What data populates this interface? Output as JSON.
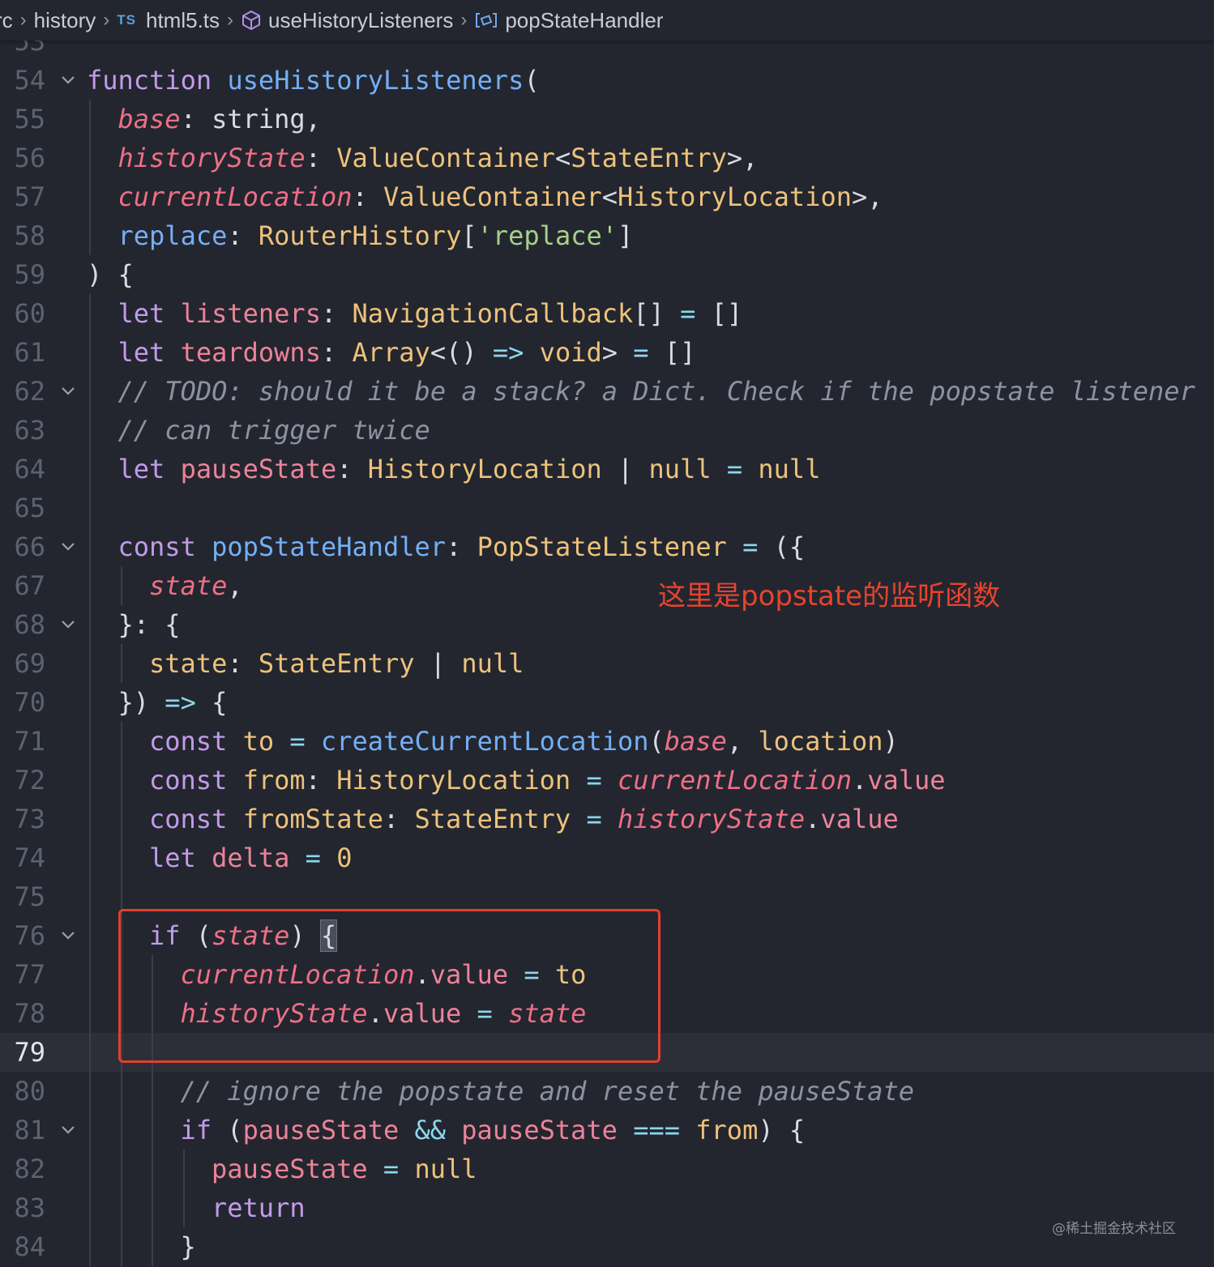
{
  "breadcrumb": {
    "items": [
      "rc",
      "history",
      "html5.ts",
      "useHistoryListeners",
      "popStateHandler"
    ],
    "ts_badge": "TS",
    "icons": [
      "chevron-right-icon",
      "typescript-file-icon",
      "method-cube-icon",
      "variable-icon"
    ]
  },
  "editor": {
    "current_line": "79",
    "lines": [
      {
        "n": "53",
        "tokens": []
      },
      {
        "n": "54",
        "tokens": [
          [
            "kw",
            "function"
          ],
          [
            "plain",
            " "
          ],
          [
            "fn",
            "useHistoryListeners"
          ],
          [
            "plain",
            "("
          ]
        ]
      },
      {
        "n": "55",
        "tokens": [
          [
            "param",
            "base"
          ],
          [
            "plain",
            ": string,"
          ]
        ]
      },
      {
        "n": "56",
        "tokens": [
          [
            "param",
            "historyState"
          ],
          [
            "plain",
            ": "
          ],
          [
            "type",
            "ValueContainer"
          ],
          [
            "plain",
            "<"
          ],
          [
            "type",
            "StateEntry"
          ],
          [
            "plain",
            ">,"
          ]
        ]
      },
      {
        "n": "57",
        "tokens": [
          [
            "param",
            "currentLocation"
          ],
          [
            "plain",
            ": "
          ],
          [
            "type",
            "ValueContainer"
          ],
          [
            "plain",
            "<"
          ],
          [
            "type",
            "HistoryLocation"
          ],
          [
            "plain",
            ">,"
          ]
        ]
      },
      {
        "n": "58",
        "tokens": [
          [
            "fn",
            "replace"
          ],
          [
            "plain",
            ": "
          ],
          [
            "type",
            "RouterHistory"
          ],
          [
            "plain",
            "["
          ],
          [
            "str",
            "'replace'"
          ],
          [
            "plain",
            "]"
          ]
        ]
      },
      {
        "n": "59",
        "tokens": [
          [
            "plain",
            ") {"
          ]
        ]
      },
      {
        "n": "60",
        "tokens": [
          [
            "kw",
            "let"
          ],
          [
            "plain",
            " "
          ],
          [
            "var",
            "listeners"
          ],
          [
            "plain",
            ": "
          ],
          [
            "type",
            "NavigationCallback"
          ],
          [
            "plain",
            "[] "
          ],
          [
            "op",
            "="
          ],
          [
            "plain",
            " []"
          ]
        ]
      },
      {
        "n": "61",
        "tokens": [
          [
            "kw",
            "let"
          ],
          [
            "plain",
            " "
          ],
          [
            "var",
            "teardowns"
          ],
          [
            "plain",
            ": "
          ],
          [
            "type",
            "Array"
          ],
          [
            "plain",
            "<() "
          ],
          [
            "op",
            "=>"
          ],
          [
            "plain",
            " "
          ],
          [
            "type",
            "void"
          ],
          [
            "plain",
            "> "
          ],
          [
            "op",
            "="
          ],
          [
            "plain",
            " []"
          ]
        ]
      },
      {
        "n": "62",
        "tokens": [
          [
            "cmt",
            "// TODO: should it be a stack? a Dict. Check if the popstate listener"
          ]
        ]
      },
      {
        "n": "63",
        "tokens": [
          [
            "cmt",
            "// can trigger twice"
          ]
        ]
      },
      {
        "n": "64",
        "tokens": [
          [
            "kw",
            "let"
          ],
          [
            "plain",
            " "
          ],
          [
            "var",
            "pauseState"
          ],
          [
            "plain",
            ": "
          ],
          [
            "type",
            "HistoryLocation"
          ],
          [
            "plain",
            " | "
          ],
          [
            "type",
            "null"
          ],
          [
            "plain",
            " "
          ],
          [
            "op",
            "="
          ],
          [
            "plain",
            " "
          ],
          [
            "type",
            "null"
          ]
        ]
      },
      {
        "n": "65",
        "tokens": []
      },
      {
        "n": "66",
        "tokens": [
          [
            "kw",
            "const"
          ],
          [
            "plain",
            " "
          ],
          [
            "fn",
            "popStateHandler"
          ],
          [
            "plain",
            ": "
          ],
          [
            "type",
            "PopStateListener"
          ],
          [
            "plain",
            " "
          ],
          [
            "op",
            "="
          ],
          [
            "plain",
            " ({"
          ]
        ]
      },
      {
        "n": "67",
        "tokens": [
          [
            "param",
            "state"
          ],
          [
            "plain",
            ","
          ]
        ]
      },
      {
        "n": "68",
        "tokens": [
          [
            "plain",
            "}: {"
          ]
        ]
      },
      {
        "n": "69",
        "tokens": [
          [
            "type",
            "state"
          ],
          [
            "plain",
            ": "
          ],
          [
            "type",
            "StateEntry"
          ],
          [
            "plain",
            " | "
          ],
          [
            "type",
            "null"
          ]
        ]
      },
      {
        "n": "70",
        "tokens": [
          [
            "plain",
            "}) "
          ],
          [
            "op",
            "=>"
          ],
          [
            "plain",
            " {"
          ]
        ]
      },
      {
        "n": "71",
        "tokens": [
          [
            "kw",
            "const"
          ],
          [
            "plain",
            " "
          ],
          [
            "type",
            "to"
          ],
          [
            "plain",
            " "
          ],
          [
            "op",
            "="
          ],
          [
            "plain",
            " "
          ],
          [
            "fn",
            "createCurrentLocation"
          ],
          [
            "plain",
            "("
          ],
          [
            "param",
            "base"
          ],
          [
            "plain",
            ", "
          ],
          [
            "type",
            "location"
          ],
          [
            "plain",
            ")"
          ]
        ]
      },
      {
        "n": "72",
        "tokens": [
          [
            "kw",
            "const"
          ],
          [
            "plain",
            " "
          ],
          [
            "type",
            "from"
          ],
          [
            "plain",
            ": "
          ],
          [
            "type",
            "HistoryLocation"
          ],
          [
            "plain",
            " "
          ],
          [
            "op",
            "="
          ],
          [
            "plain",
            " "
          ],
          [
            "param",
            "currentLocation"
          ],
          [
            "plain",
            "."
          ],
          [
            "var",
            "value"
          ]
        ]
      },
      {
        "n": "73",
        "tokens": [
          [
            "kw",
            "const"
          ],
          [
            "plain",
            " "
          ],
          [
            "type",
            "fromState"
          ],
          [
            "plain",
            ": "
          ],
          [
            "type",
            "StateEntry"
          ],
          [
            "plain",
            " "
          ],
          [
            "op",
            "="
          ],
          [
            "plain",
            " "
          ],
          [
            "param",
            "historyState"
          ],
          [
            "plain",
            "."
          ],
          [
            "var",
            "value"
          ]
        ]
      },
      {
        "n": "74",
        "tokens": [
          [
            "kw",
            "let"
          ],
          [
            "plain",
            " "
          ],
          [
            "var",
            "delta"
          ],
          [
            "plain",
            " "
          ],
          [
            "op",
            "="
          ],
          [
            "plain",
            " "
          ],
          [
            "type",
            "0"
          ]
        ]
      },
      {
        "n": "75",
        "tokens": []
      },
      {
        "n": "76",
        "tokens": [
          [
            "kw",
            "if"
          ],
          [
            "plain",
            " ("
          ],
          [
            "param",
            "state"
          ],
          [
            "plain",
            ") "
          ],
          [
            "hl",
            "{"
          ]
        ]
      },
      {
        "n": "77",
        "tokens": [
          [
            "param",
            "currentLocation"
          ],
          [
            "plain",
            "."
          ],
          [
            "var",
            "value"
          ],
          [
            "plain",
            " "
          ],
          [
            "op",
            "="
          ],
          [
            "plain",
            " "
          ],
          [
            "type",
            "to"
          ]
        ]
      },
      {
        "n": "78",
        "tokens": [
          [
            "param",
            "historyState"
          ],
          [
            "plain",
            "."
          ],
          [
            "var",
            "value"
          ],
          [
            "plain",
            " "
          ],
          [
            "op",
            "="
          ],
          [
            "plain",
            " "
          ],
          [
            "param",
            "state"
          ]
        ]
      },
      {
        "n": "79",
        "tokens": []
      },
      {
        "n": "80",
        "tokens": [
          [
            "cmt",
            "// ignore the popstate and reset the pauseState"
          ]
        ]
      },
      {
        "n": "81",
        "tokens": [
          [
            "kw",
            "if"
          ],
          [
            "plain",
            " ("
          ],
          [
            "var",
            "pauseState"
          ],
          [
            "plain",
            " "
          ],
          [
            "op",
            "&&"
          ],
          [
            "plain",
            " "
          ],
          [
            "var",
            "pauseState"
          ],
          [
            "plain",
            " "
          ],
          [
            "op",
            "==="
          ],
          [
            "plain",
            " "
          ],
          [
            "type",
            "from"
          ],
          [
            "plain",
            ") {"
          ]
        ]
      },
      {
        "n": "82",
        "tokens": [
          [
            "var",
            "pauseState"
          ],
          [
            "plain",
            " "
          ],
          [
            "op",
            "="
          ],
          [
            "plain",
            " "
          ],
          [
            "type",
            "null"
          ]
        ]
      },
      {
        "n": "83",
        "tokens": [
          [
            "kw",
            "return"
          ]
        ]
      },
      {
        "n": "84",
        "tokens": [
          [
            "plain",
            "}"
          ]
        ]
      }
    ]
  },
  "annotation": {
    "text": "这里是popstate的监听函数"
  },
  "watermark": {
    "text": "@稀土掘金技术社区"
  },
  "colors": {
    "background": "#23262f",
    "keyword": "#c39bea",
    "function": "#74aff5",
    "type": "#edc27b",
    "param": "#ee6f86",
    "string": "#a6d189",
    "comment": "#8d92a2",
    "annotation_red": "#e0402e"
  }
}
